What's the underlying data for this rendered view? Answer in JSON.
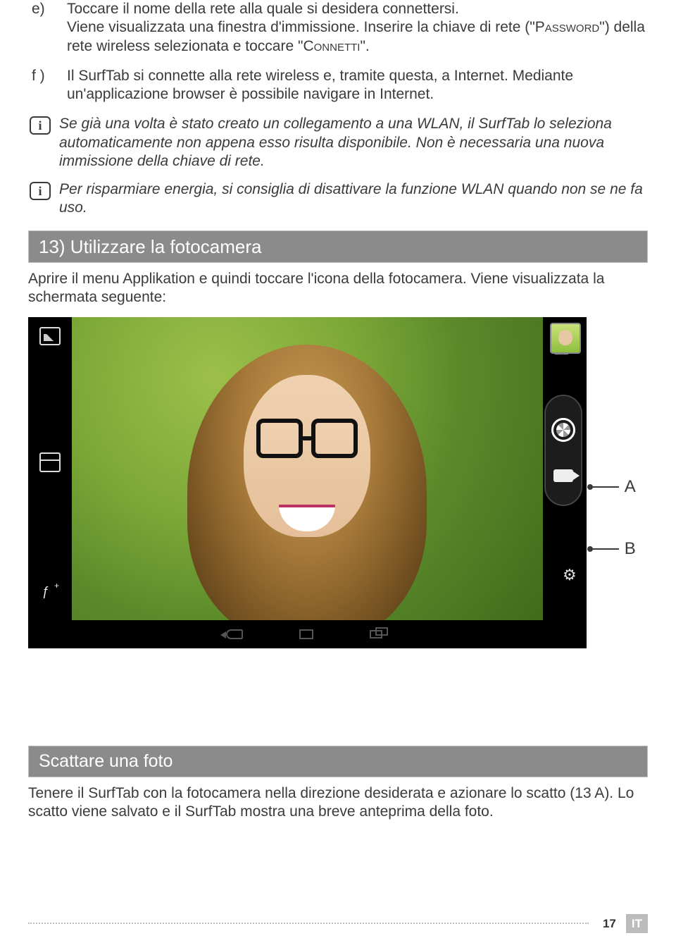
{
  "steps": {
    "e": {
      "letter": "e)",
      "line1": "Toccare il nome della rete alla quale si desidera connettersi.",
      "line2_a": "Viene visualizzata una finestra d'immissione. Inserire la chiave di rete (\"",
      "password": "Password",
      "line2_b": "\") della rete wireless selezionata e toccare \"",
      "connetti": "Connetti",
      "line2_c": "\"."
    },
    "f": {
      "letter": "f )",
      "text": "Il SurfTab si connette alla rete wireless e, tramite questa, a Internet. Mediante un'applicazione browser è possibile navigare in Internet."
    }
  },
  "info1": "Se già una volta è stato creato un collegamento a una WLAN, il SurfTab lo seleziona automaticamente non appena esso risulta disponibile. Non è necessaria una nuova immissione della chiave di rete.",
  "info2": "Per risparmiare energia, si consiglia di disattivare la funzione WLAN quando non se ne fa uso.",
  "section13": {
    "title": "13) Utilizzare la fotocamera",
    "body": "Aprire il menu Applikation e quindi toccare l'icona della fotocamera. Viene visualizzata la schermata seguente:"
  },
  "callouts": {
    "a": "A",
    "b": "B"
  },
  "sectionShot": {
    "title": "Scattare una foto",
    "body": "Tenere il SurfTab con la fotocamera nella direzione desiderata e azionare lo scatto (13 A). Lo scatto viene salvato e il SurfTab mostra una breve anteprima della foto."
  },
  "footer": {
    "page": "17",
    "lang": "IT"
  },
  "info_glyph": "i"
}
